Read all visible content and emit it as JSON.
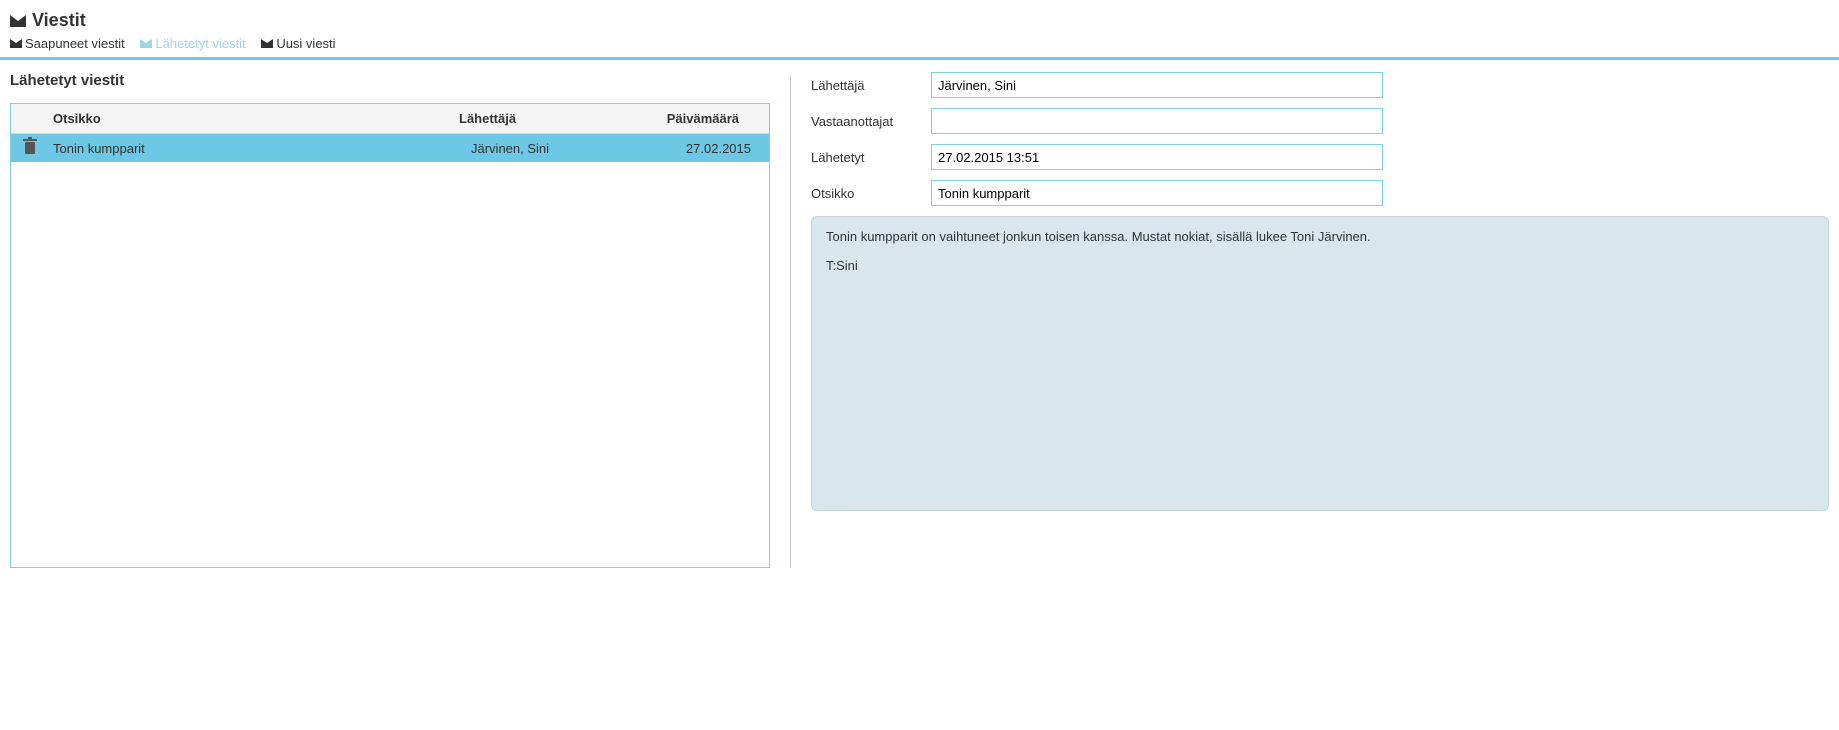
{
  "header": {
    "title": "Viestit"
  },
  "tabs": {
    "inbox": "Saapuneet viestit",
    "sent": "Lähetetyt viestit",
    "new": "Uusi viesti"
  },
  "list": {
    "heading": "Lähetetyt viestit",
    "columns": {
      "subject": "Otsikko",
      "sender": "Lähettäjä",
      "date": "Päivämäärä"
    },
    "rows": [
      {
        "subject": "Tonin kumpparit",
        "sender": "Järvinen, Sini",
        "date": "27.02.2015"
      }
    ]
  },
  "detail": {
    "labels": {
      "sender": "Lähettäjä",
      "recipients": "Vastaanottajat",
      "sent": "Lähetetyt",
      "subject": "Otsikko"
    },
    "values": {
      "sender": "Järvinen, Sini",
      "recipients": "",
      "sent": "27.02.2015 13:51",
      "subject": "Tonin kumpparit"
    },
    "body": {
      "line1": "Tonin kumpparit on vaihtuneet jonkun toisen kanssa. Mustat nokiat, sisällä lukee Toni Järvinen.",
      "line2": "T:Sini"
    }
  }
}
